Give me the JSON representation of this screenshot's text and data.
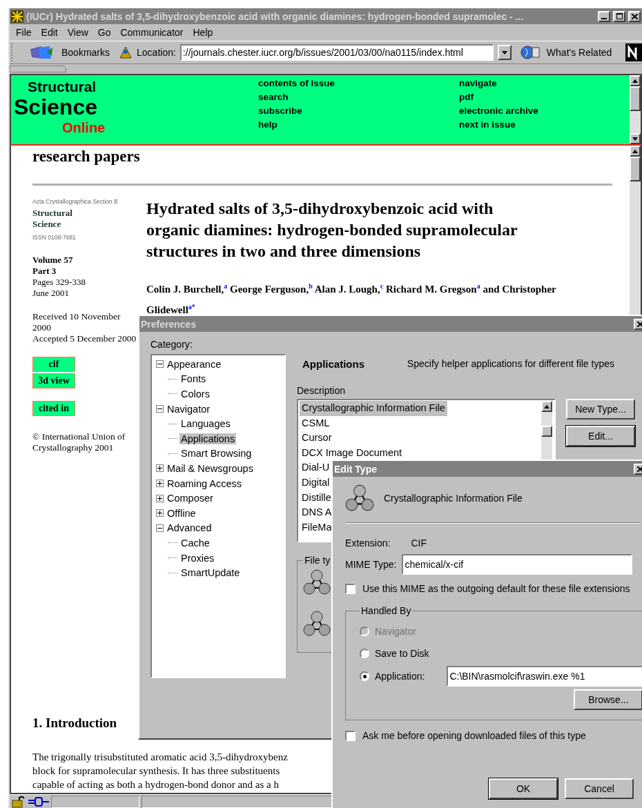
{
  "window": {
    "title": "(IUCr) Hydrated salts of 3,5-dihydroxybenzoic acid with organic diamines: hydrogen-bonded supramolec - ..."
  },
  "menu": [
    "File",
    "Edit",
    "View",
    "Go",
    "Communicator",
    "Help"
  ],
  "toolbar": {
    "bookmarks": "Bookmarks",
    "location_label": "Location:",
    "url": "://journals.chester.iucr.org/b/issues/2001/03/00/na0115/index.html",
    "related": "What's Related"
  },
  "header": {
    "logo": [
      "Structural",
      "Science",
      "Online"
    ],
    "links_left": [
      "contents of issue",
      "search",
      "subscribe",
      "help"
    ],
    "links_right": [
      "navigate",
      "pdf",
      "electronic archive",
      "next in issue"
    ]
  },
  "page": {
    "heading": "research papers",
    "journal": "Acta Crystallographica Section B",
    "section": [
      "Structural",
      "Science"
    ],
    "issn": "ISSN 0108-7681",
    "issue": [
      {
        "text": "Volume 57",
        "bold": true
      },
      {
        "text": "Part 3",
        "bold": true
      },
      {
        "text": "Pages 329-338",
        "bold": false
      },
      {
        "text": "June 2001",
        "bold": false
      }
    ],
    "dates": [
      "Received 10 November 2000",
      "Accepted 5 December 2000"
    ],
    "link_groups": [
      [
        "cif",
        "3d view"
      ],
      [
        "cited in"
      ]
    ],
    "copyright": "© International Union of Crystallography 2001",
    "title": "Hydrated salts of 3,5-dihydroxybenzoic acid with organic diamines: hydrogen-bonded supramolecular structures in two and three dimensions",
    "authors": "Colin J. Burchell,$^{a}$ George Ferguson,$^{b}$ Alan J. Lough,$^{c}$ Richard M. Gregson$^{a}$ and Christopher Glidewell$^{a*}$",
    "section_heading": "1. Introduction",
    "paragraph_lines": [
      "The trigonally trisubstituted aromatic acid 3,5-dihydroxybenz",
      "block for supramolecular synthesis. It has three substituents",
      "capable of acting as both a hydrogen-bond donor and as a h"
    ]
  },
  "preferences": {
    "title": "Preferences",
    "category_label": "Category:",
    "category": [
      {
        "label": "Appearance",
        "expanded": true,
        "selected": false,
        "children": [
          {
            "label": "Fonts",
            "selected": false
          },
          {
            "label": "Colors",
            "selected": false
          }
        ]
      },
      {
        "label": "Navigator",
        "expanded": true,
        "selected": false,
        "children": [
          {
            "label": "Languages",
            "selected": false
          },
          {
            "label": "Applications",
            "selected": true
          },
          {
            "label": "Smart Browsing",
            "selected": false
          }
        ]
      },
      {
        "label": "Mail & Newsgroups",
        "expanded": false,
        "selected": false
      },
      {
        "label": "Roaming Access",
        "expanded": false,
        "selected": false
      },
      {
        "label": "Composer",
        "expanded": false,
        "selected": false
      },
      {
        "label": "Offline",
        "expanded": false,
        "selected": false
      },
      {
        "label": "Advanced",
        "expanded": true,
        "selected": false,
        "children": [
          {
            "label": "Cache",
            "selected": false
          },
          {
            "label": "Proxies",
            "selected": false
          },
          {
            "label": "SmartUpdate",
            "selected": false
          }
        ]
      }
    ],
    "panel_title": "Applications",
    "panel_hint": "Specify helper applications for different file types",
    "description_label": "Description",
    "types": [
      {
        "label": "Crystallographic Information File",
        "selected": true
      },
      {
        "label": "CSML",
        "selected": false
      },
      {
        "label": "Cursor",
        "selected": false
      },
      {
        "label": "DCX Image Document",
        "selected": false
      },
      {
        "label": "Dial-U",
        "selected": false
      },
      {
        "label": "Digital",
        "selected": false
      },
      {
        "label": "Distille",
        "selected": false
      },
      {
        "label": "DNS A",
        "selected": false
      },
      {
        "label": "FileMa",
        "selected": false
      }
    ],
    "buttons": [
      {
        "label": "New Type...",
        "default": false
      },
      {
        "label": "Edit...",
        "default": true
      }
    ],
    "file_type_label": "File ty"
  },
  "edit_type": {
    "title": "Edit Type",
    "file_label": "Crystallographic Information File",
    "extension_label": "Extension:",
    "extension": "CIF",
    "mime_label": "MIME Type:",
    "mime": "chemical/x-cif",
    "default_mime": {
      "label": "Use this MIME as the outgoing default for these file extensions",
      "checked": false
    },
    "handled_by": "Handled By",
    "handlers": [
      {
        "label": "Navigator",
        "selected": false,
        "disabled": true
      },
      {
        "label": "Save to Disk",
        "selected": false,
        "disabled": false
      },
      {
        "label": "Application:",
        "selected": true,
        "disabled": false,
        "value": "C:\\BIN\\rasmolcif\\raswin.exe %1"
      }
    ],
    "browse": "Browse...",
    "ask": {
      "label": "Ask me before opening downloaded files of this type",
      "checked": false
    },
    "buttons": [
      {
        "label": "OK",
        "default": true
      },
      {
        "label": "Cancel",
        "default": false
      }
    ]
  }
}
